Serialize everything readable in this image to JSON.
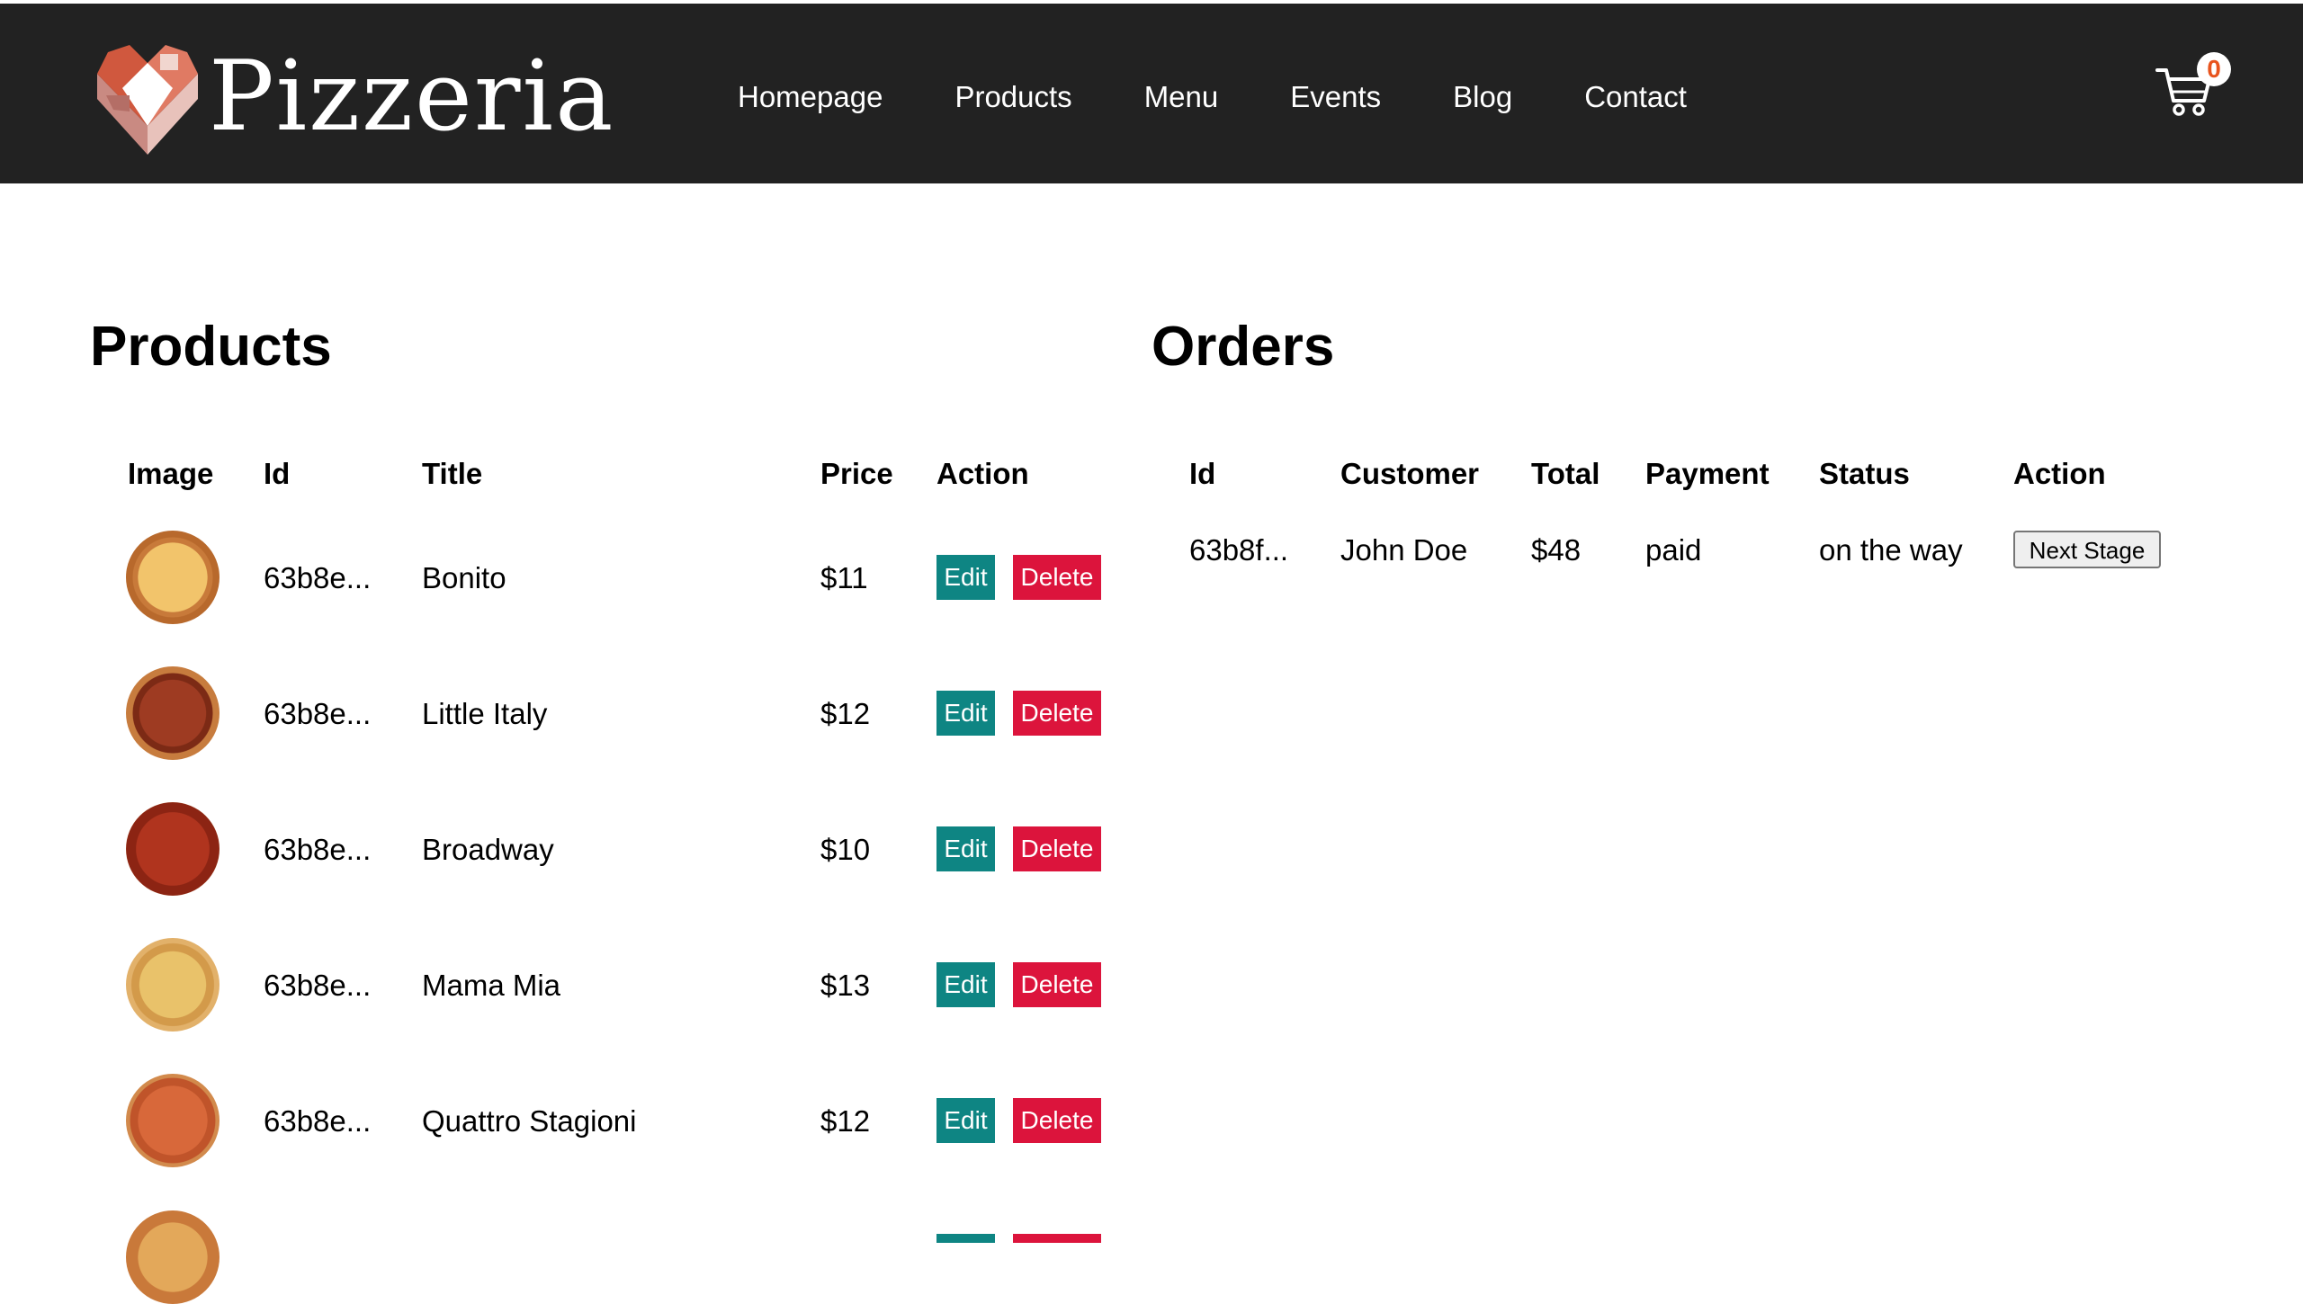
{
  "brand": {
    "name": "Pizzeria"
  },
  "nav": {
    "items": [
      "Homepage",
      "Products",
      "Menu",
      "Events",
      "Blog",
      "Contact"
    ]
  },
  "cart": {
    "count": "0",
    "icon": "cart-icon"
  },
  "products": {
    "title": "Products",
    "columns": [
      "Image",
      "Id",
      "Title",
      "Price",
      "Action"
    ],
    "edit_label": "Edit",
    "delete_label": "Delete",
    "rows": [
      {
        "id": "63b8e...",
        "title": "Bonito",
        "price": "$11"
      },
      {
        "id": "63b8e...",
        "title": "Little Italy",
        "price": "$12"
      },
      {
        "id": "63b8e...",
        "title": "Broadway",
        "price": "$10"
      },
      {
        "id": "63b8e...",
        "title": "Mama Mia",
        "price": "$13"
      },
      {
        "id": "63b8e...",
        "title": "Quattro Stagioni",
        "price": "$12"
      }
    ]
  },
  "orders": {
    "title": "Orders",
    "columns": [
      "Id",
      "Customer",
      "Total",
      "Payment",
      "Status",
      "Action"
    ],
    "rows": [
      {
        "id": "63b8f...",
        "customer": "John Doe",
        "total": "$48",
        "payment": "paid",
        "status": "on the way",
        "action_label": "Next Stage"
      }
    ]
  },
  "colors": {
    "navbar": "#222222",
    "edit_button": "#0e8583",
    "delete_button": "#dc143c",
    "badge_text": "#e8541e"
  }
}
